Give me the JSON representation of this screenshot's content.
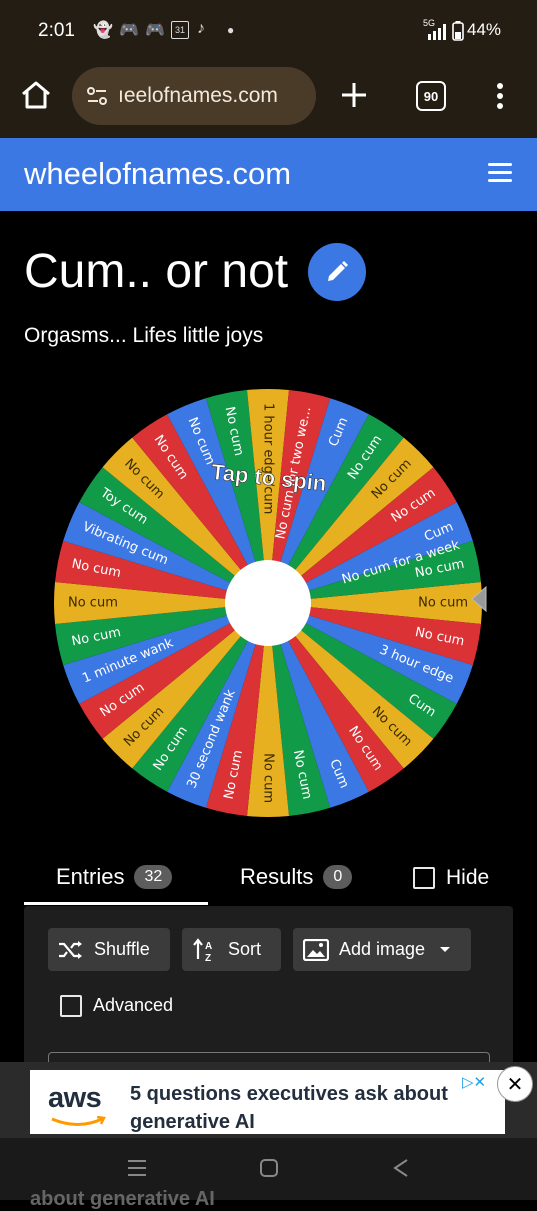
{
  "status_bar": {
    "time": "2:01",
    "notification_icons": [
      "snapchat-icon",
      "discord-icon",
      "discord-icon",
      "calendar-icon",
      "tiktok-icon",
      "dot-icon"
    ],
    "calendar_day": "31",
    "network": "5G",
    "battery": "44%"
  },
  "browser": {
    "url": "ıeelofnames.com",
    "tab_count": "90"
  },
  "site": {
    "brand": "wheelofnames.com"
  },
  "wheel_page": {
    "title": "Cum.. or not",
    "subtitle": "Orgasms... Lifes little joys",
    "tap_to_spin": "Tap to spin",
    "colors": [
      "#e7b020",
      "#db3236",
      "#3c78e4",
      "#119b48"
    ],
    "segments": [
      "No cum",
      "No cum",
      "3 hour edge",
      "Cum",
      "No cum",
      "No cum",
      "Cum",
      "No cum",
      "No cum",
      "No cum",
      "30 second wank",
      "No cum",
      "No cum",
      "No cum",
      "1 minute wank",
      "No cum",
      "No cum",
      "No cum",
      "Vibrating cum",
      "Toy cum",
      "No cum",
      "No cum",
      "No cum",
      "No cum",
      "1 hour edge/cum",
      "No cum for two we...",
      "Cum",
      "No cum",
      "No cum",
      "No cum",
      "Cum",
      "No cum"
    ],
    "long_segment_extra": "No cum for a week"
  },
  "tabs": {
    "entries_label": "Entries",
    "entries_count": "32",
    "results_label": "Results",
    "results_count": "0",
    "hide_label": "Hide"
  },
  "toolbar": {
    "shuffle_label": "Shuffle",
    "sort_label": "Sort",
    "add_image_label": "Add image",
    "advanced_label": "Advanced"
  },
  "ad": {
    "brand": "aws",
    "text": "5 questions executives ask about generative AI",
    "peek_text": "about generative AI"
  }
}
